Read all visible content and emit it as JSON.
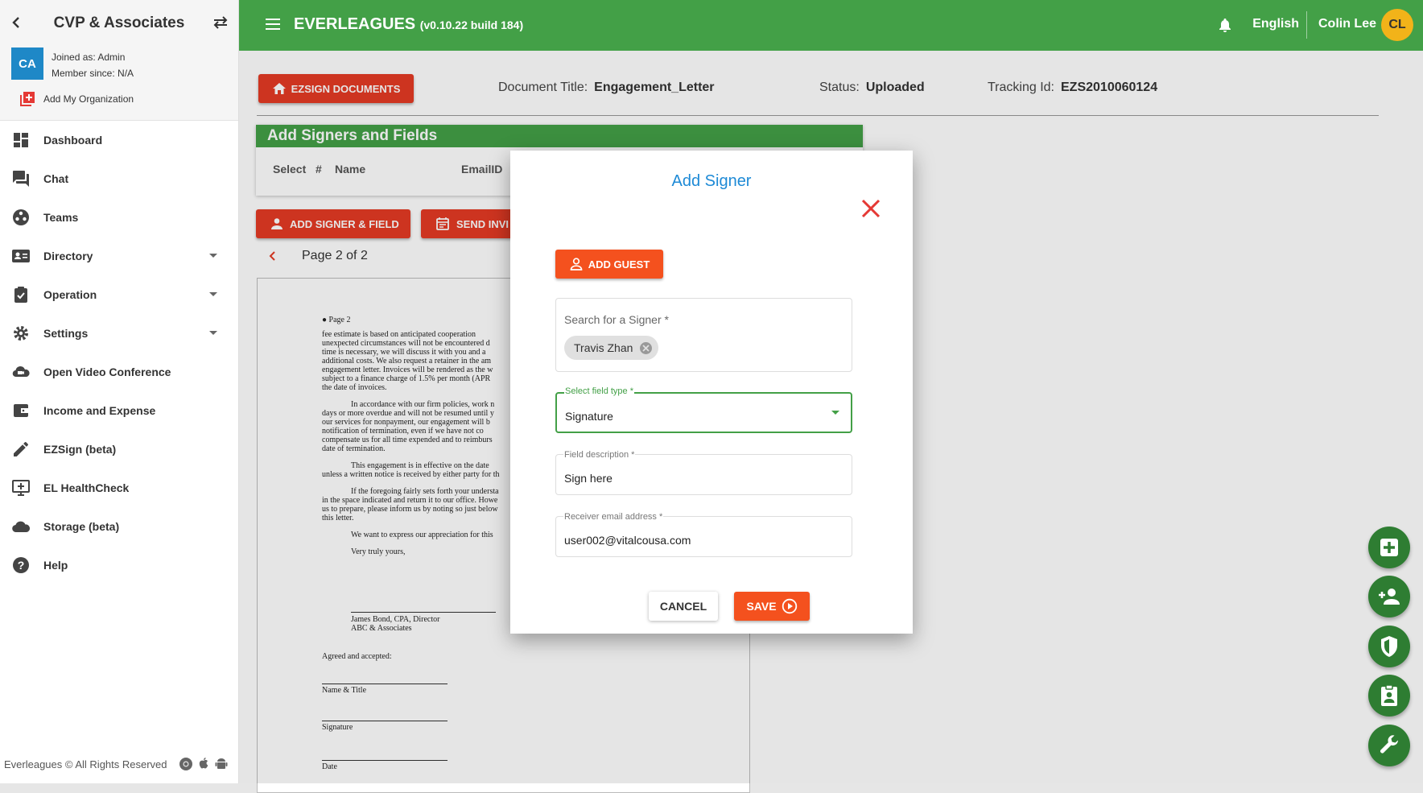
{
  "org": {
    "name": "CVP & Associates",
    "initials": "CA",
    "joined_as": "Joined as: Admin",
    "member_since": "Member since: N/A",
    "add_org": "Add My Organization"
  },
  "nav": {
    "items": [
      {
        "label": "Dashboard",
        "icon": "dashboard-icon"
      },
      {
        "label": "Chat",
        "icon": "chat-icon"
      },
      {
        "label": "Teams",
        "icon": "teams-icon"
      },
      {
        "label": "Directory",
        "icon": "directory-icon"
      },
      {
        "label": "Operation",
        "icon": "operation-icon"
      },
      {
        "label": "Settings",
        "icon": "gear-icon"
      },
      {
        "label": "Open Video Conference",
        "icon": "cloud-icon"
      },
      {
        "label": "Income and Expense",
        "icon": "wallet-icon"
      },
      {
        "label": "EZSign (beta)",
        "icon": "pencil-icon"
      },
      {
        "label": "EL HealthCheck",
        "icon": "monitor-plus-icon"
      },
      {
        "label": "Storage (beta)",
        "icon": "cloud-storage-icon"
      },
      {
        "label": "Help",
        "icon": "help-icon"
      }
    ]
  },
  "footer": {
    "text": "Everleagues © All Rights Reserved"
  },
  "header": {
    "app_name": "EVERLEAGUES",
    "version": "(v0.10.22 build 184)",
    "language": "English",
    "user_name": "Colin Lee",
    "user_initials": "CL"
  },
  "document": {
    "ezsign_button": "EZSIGN DOCUMENTS",
    "title_label": "Document Title:",
    "title_value": "Engagement_Letter",
    "status_label": "Status:",
    "status_value": "Uploaded",
    "tracking_label": "Tracking Id:",
    "tracking_value": "EZS2010060124"
  },
  "signers_panel": {
    "title": "Add Signers and Fields",
    "columns": [
      "Select",
      "#",
      "Name",
      "EmailID"
    ],
    "add_signer_button": "ADD SIGNER & FIELD",
    "send_invite_button": "SEND INVI"
  },
  "pager": {
    "text": "Page 2 of 2"
  },
  "doc_preview": {
    "lines": [
      "● Page 2",
      "fee estimate is based on anticipated cooperation",
      "unexpected circumstances will not be encountered d",
      "time is necessary, we will discuss it with you and a",
      "additional costs. We also request a retainer in the am",
      "engagement letter. Invoices will be rendered as the w",
      "subject to a finance charge of 1.5% per month (APR",
      "the date of invoices.",
      "In accordance with our firm policies, work n",
      "days or more overdue and will not be resumed until y",
      "our services for nonpayment, our engagement will b",
      "notification of termination, even if we have not co",
      "compensate us for all time expended and to reimburs",
      "date of termination.",
      "This engagement is in effective on the date",
      "unless a written notice is received by either party for th",
      "If the foregoing fairly sets forth your understa",
      "in the space indicated and return it to our office. Howe",
      "us to prepare, please inform us by noting so just below",
      "this letter.",
      "We want to express our appreciation for this",
      "Very truly yours,",
      "James Bond, CPA, Director",
      "ABC & Associates",
      "Agreed and accepted:",
      "Name & Title",
      "Signature",
      "Date"
    ]
  },
  "modal": {
    "title": "Add Signer",
    "add_guest_button": "ADD GUEST",
    "search_placeholder": "Search for a Signer *",
    "selected_signer": "Travis Zhan",
    "field_type_label": "Select field type *",
    "field_type_value": "Signature",
    "description_label": "Field description *",
    "description_value": "Sign here",
    "email_label": "Receiver email address *",
    "email_value": "user002@vitalcousa.com",
    "cancel_button": "CANCEL",
    "save_button": "SAVE"
  },
  "fabs": [
    "add-icon",
    "add-user-icon",
    "shield-icon",
    "contact-icon",
    "wrench-icon"
  ],
  "colors": {
    "primary_green": "#43a047",
    "accent_red": "#e53a24",
    "accent_orange": "#f4511e",
    "link_blue": "#1e8ad6",
    "avatar_gold": "#f2b319",
    "org_blue": "#1e88c7"
  }
}
